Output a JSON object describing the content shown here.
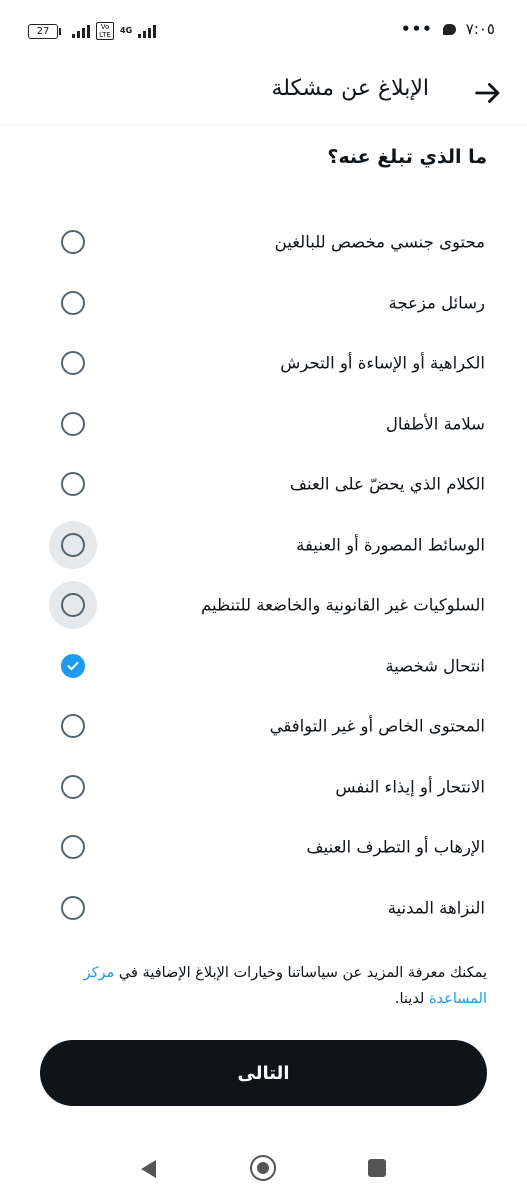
{
  "status_bar": {
    "battery": "27",
    "volte": "Vo LTE",
    "network": "4G",
    "more": "•••",
    "time": "٧:٠٥"
  },
  "header": {
    "title": "الإبلاغ عن مشكلة",
    "back_icon": "arrow-right-icon"
  },
  "question": "ما الذي تبلغ عنه؟",
  "options": [
    {
      "label": "محتوى جنسي مخصص للبالغين",
      "checked": false
    },
    {
      "label": "رسائل مزعجة",
      "checked": false
    },
    {
      "label": "الكراهية أو الإساءة أو التحرش",
      "checked": false
    },
    {
      "label": "سلامة الأطفال",
      "checked": false
    },
    {
      "label": "الكلام الذي يحضّ على العنف",
      "checked": false
    },
    {
      "label": "الوسائط المصورة أو العنيفة",
      "checked": false
    },
    {
      "label": "السلوكيات غير القانونية والخاضعة للتنظيم",
      "checked": false
    },
    {
      "label": "انتحال شخصية",
      "checked": true
    },
    {
      "label": "المحتوى الخاص أو غير التوافقي",
      "checked": false
    },
    {
      "label": "الانتحار أو إيذاء النفس",
      "checked": false
    },
    {
      "label": "الإرهاب أو التطرف العنيف",
      "checked": false
    },
    {
      "label": "النزاهة المدنية",
      "checked": false
    }
  ],
  "footer": {
    "text_before": "يمكنك معرفة المزيد عن سياساتنا وخيارات الإبلاغ الإضافية في ",
    "link": "مركز المساعدة",
    "text_after": " لدينا."
  },
  "next_button": "التالى",
  "colors": {
    "accent": "#1d9bf0",
    "primary": "#0f1419",
    "radio_border": "#536471"
  }
}
